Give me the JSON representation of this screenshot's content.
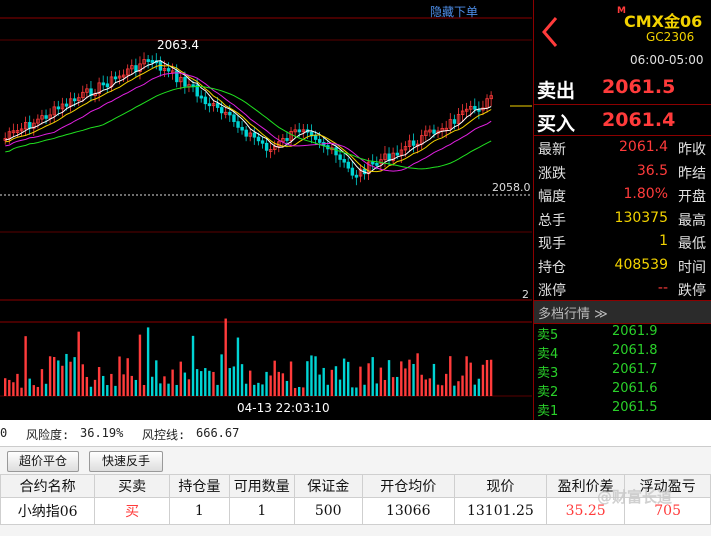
{
  "chart": {
    "hide_order_label": "隐藏下单",
    "high_label": "2063.4",
    "price_line_label": "2058.0",
    "small_label": "2",
    "crosshair_time": "04-13 22:03:10",
    "colors": {
      "up": "#ff3b3b",
      "down": "#00d4d4",
      "ma1": "#ffffff",
      "ma2": "#f2d200",
      "ma3": "#e020e0",
      "ma4": "#20e020"
    }
  },
  "quote": {
    "symbol_flag": "M",
    "symbol_name": "CMX金06",
    "symbol_code": "GC2306",
    "session": "06:00-05:00",
    "sell_label": "卖出",
    "sell_price": "2061.5",
    "buy_label": "买入",
    "buy_price": "2061.4",
    "rows": [
      {
        "k": "最新",
        "v": "2061.4",
        "k2": "昨收",
        "color": "red"
      },
      {
        "k": "涨跌",
        "v": "36.5",
        "k2": "昨结",
        "color": "red"
      },
      {
        "k": "幅度",
        "v": "1.80%",
        "k2": "开盘",
        "color": "red"
      },
      {
        "k": "总手",
        "v": "130375",
        "k2": "最高",
        "color": "yel"
      },
      {
        "k": "现手",
        "v": "1",
        "k2": "最低",
        "color": "yel"
      },
      {
        "k": "持仓",
        "v": "408539",
        "k2": "时间",
        "color": "yel"
      },
      {
        "k": "涨停",
        "v": "--",
        "k2": "跌停",
        "color": "red"
      }
    ],
    "depth_title": "多档行情 ≫",
    "depth": [
      {
        "k": "卖5",
        "v": "2061.9"
      },
      {
        "k": "卖4",
        "v": "2061.8"
      },
      {
        "k": "卖3",
        "v": "2061.7"
      },
      {
        "k": "卖2",
        "v": "2061.6"
      },
      {
        "k": "卖1",
        "v": "2061.5"
      }
    ]
  },
  "account": {
    "status_left": "0",
    "risk_label": "风险度:",
    "risk_value": "36.19%",
    "control_label": "风控线:",
    "control_value": "666.67"
  },
  "buttons": {
    "close_label": "超价平仓",
    "reverse_label": "快速反手"
  },
  "positions": {
    "headers": [
      "合约名称",
      "买卖",
      "持仓量",
      "可用数量",
      "保证金",
      "开仓均价",
      "现价",
      "盈利价差",
      "浮动盈亏"
    ],
    "rows": [
      [
        "小纳指06",
        "买",
        "1",
        "1",
        "500",
        "13066",
        "13101.25",
        "35.25",
        "705"
      ]
    ]
  },
  "watermark": "@财富长道"
}
